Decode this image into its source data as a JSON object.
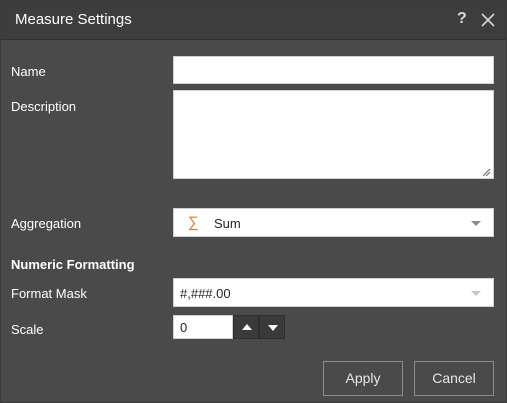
{
  "dialog": {
    "title": "Measure Settings",
    "help_label": "?"
  },
  "fields": {
    "name_label": "Name",
    "name_value": "",
    "description_label": "Description",
    "description_value": "",
    "aggregation_label": "Aggregation",
    "aggregation_value": "Sum",
    "aggregation_icon": "sigma-icon",
    "numeric_formatting_heading": "Numeric Formatting",
    "format_mask_label": "Format Mask",
    "format_mask_value": "#,###.00",
    "scale_label": "Scale",
    "scale_value": "0"
  },
  "buttons": {
    "apply": "Apply",
    "cancel": "Cancel"
  },
  "colors": {
    "background": "#4a4a4a",
    "titlebar": "#3d3d3d",
    "accent_sigma": "#e07b2b"
  }
}
